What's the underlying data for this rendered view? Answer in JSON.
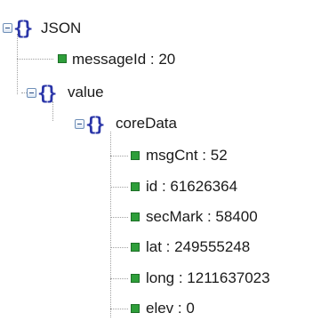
{
  "tree": {
    "root": {
      "label": "JSON",
      "icon": "braces-icon",
      "children": {
        "messageId": {
          "key": "messageId",
          "value": "20",
          "display": "messageId : 20"
        },
        "value": {
          "label": "value",
          "icon": "braces-icon",
          "coreData": {
            "label": "coreData",
            "icon": "braces-icon",
            "items": [
              {
                "display": "msgCnt : 52"
              },
              {
                "display": "id : 61626364"
              },
              {
                "display": "secMark : 58400"
              },
              {
                "display": "lat : 249555248"
              },
              {
                "display": "long : 1211637023"
              },
              {
                "display": "elev : 0"
              }
            ]
          }
        }
      }
    }
  },
  "colors": {
    "brace": "#2a35a8",
    "leaf": "#2e9e3a",
    "toggle_border": "#6f8fb8"
  }
}
